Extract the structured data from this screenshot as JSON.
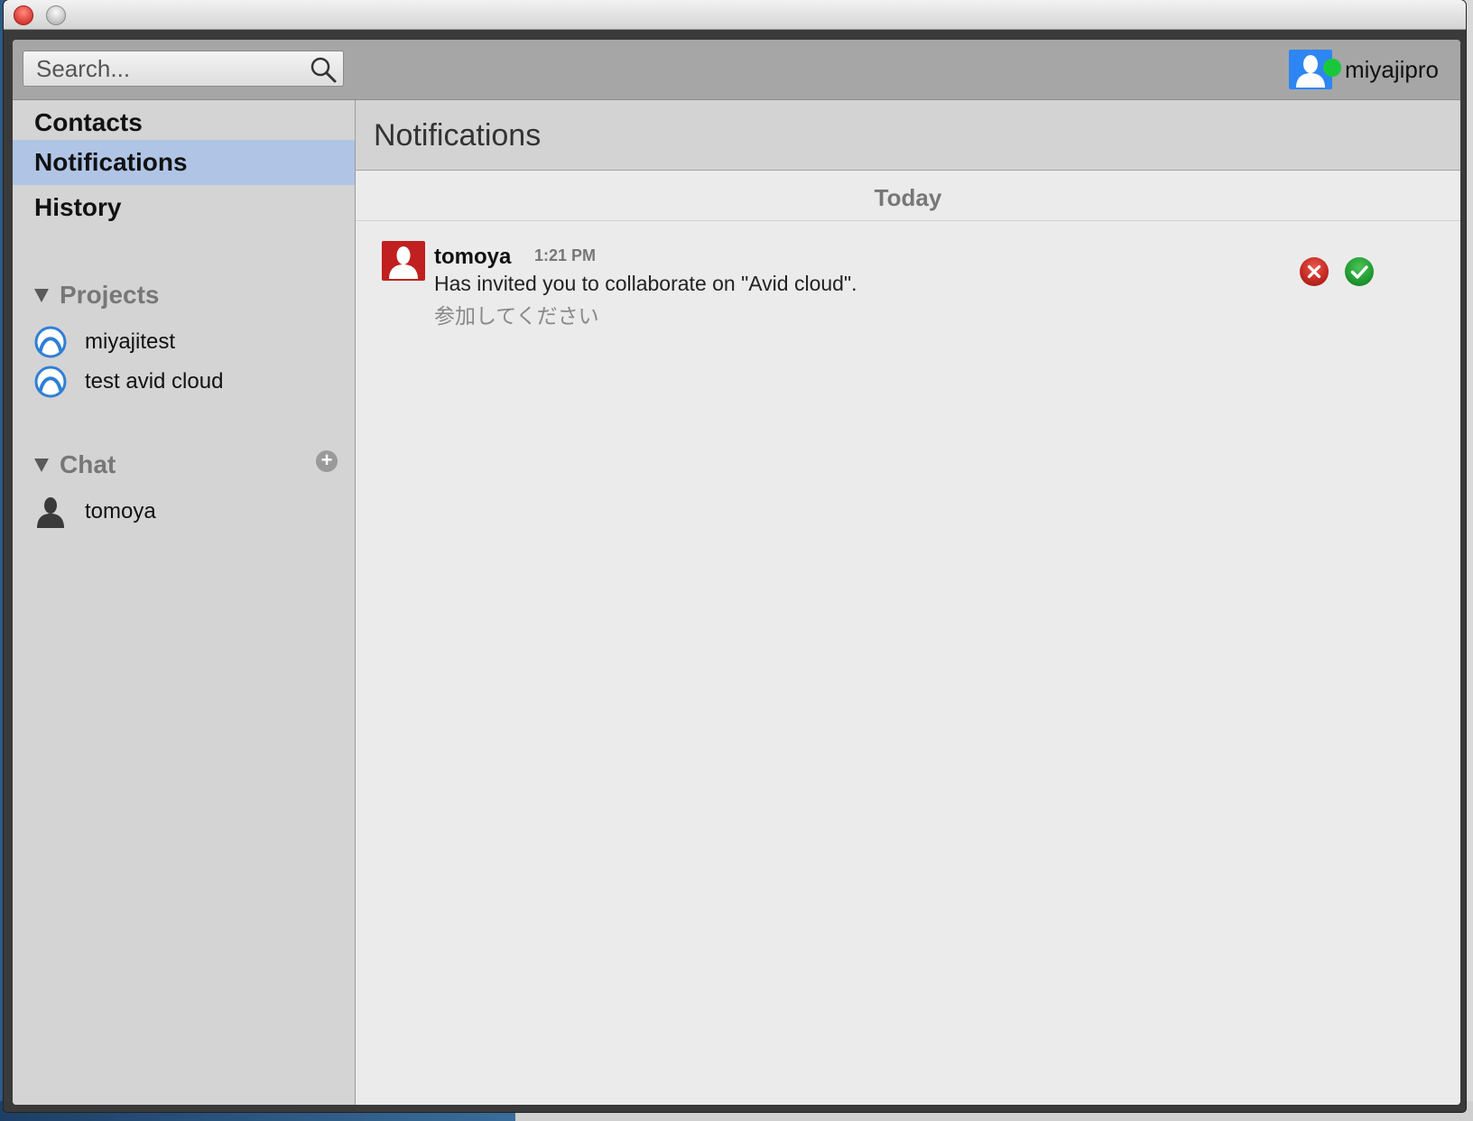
{
  "window": {
    "controls": [
      "close",
      "minimize"
    ]
  },
  "search": {
    "placeholder": "Search..."
  },
  "user": {
    "name": "miyajipro",
    "status": "online",
    "status_color": "#19c83a"
  },
  "nav": [
    {
      "label": "Contacts",
      "selected": false
    },
    {
      "label": "Notifications",
      "selected": true
    },
    {
      "label": "History",
      "selected": false
    }
  ],
  "projects": {
    "title": "Projects",
    "items": [
      {
        "label": "miyajitest"
      },
      {
        "label": "test avid cloud"
      }
    ]
  },
  "chat": {
    "title": "Chat",
    "add_label": "+",
    "items": [
      {
        "label": "tomoya"
      }
    ]
  },
  "main": {
    "title": "Notifications",
    "day": "Today",
    "notifications": [
      {
        "sender": "tomoya",
        "time": "1:21 PM",
        "message": "Has invited you to collaborate on \"Avid cloud\".",
        "note": "参加してください",
        "decline_icon": "x-circle-icon",
        "accept_icon": "check-circle-icon"
      }
    ]
  },
  "colors": {
    "selection": "#b0c5e6",
    "user_avatar_bg": "#2e86f2",
    "sender_avatar_bg": "#c0201f",
    "decline": "#c1271f",
    "accept": "#1f9a30"
  }
}
